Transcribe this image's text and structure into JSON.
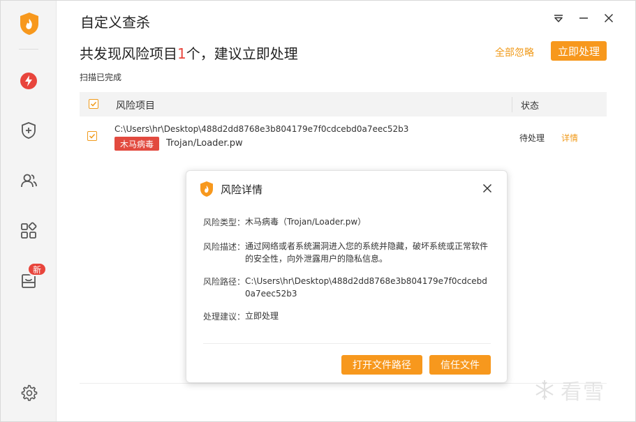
{
  "window": {
    "title": "自定义查杀"
  },
  "sidebar": {
    "items": [
      {
        "name": "quick-scan",
        "icon": "lightning-icon"
      },
      {
        "name": "protection",
        "icon": "shield-plus-icon"
      },
      {
        "name": "accounts",
        "icon": "users-icon"
      },
      {
        "name": "apps",
        "icon": "apps-grid-icon"
      },
      {
        "name": "toolbox",
        "icon": "box-icon",
        "badge": "新"
      },
      {
        "name": "settings",
        "icon": "gear-icon"
      }
    ]
  },
  "header": {
    "headline_prefix": "共发现风险项目",
    "headline_count": "1",
    "headline_suffix": "个，建议立即处理",
    "ignore_all": "全部忽略",
    "handle_now": "立即处理",
    "scan_status": "扫描已完成"
  },
  "table": {
    "col_risk": "风险项目",
    "col_status": "状态",
    "rows": [
      {
        "path": "C:\\Users\\hr\\Desktop\\488d2dd8768e3b804179e7f0cdcebd0a7eec52b3",
        "tag": "木马病毒",
        "name": "Trojan/Loader.pw",
        "status": "待处理",
        "detail": "详情"
      }
    ]
  },
  "modal": {
    "title": "风险详情",
    "type_label": "风险类型：",
    "type_value": "木马病毒（Trojan/Loader.pw）",
    "desc_label": "风险描述：",
    "desc_value": "通过网络或者系统漏洞进入您的系统并隐藏，破坏系统或正常软件的安全性，向外泄露用户的隐私信息。",
    "path_label": "风险路径：",
    "path_value": "C:\\Users\\hr\\Desktop\\488d2dd8768e3b804179e7f0cdcebd0a7eec52b3",
    "advice_label": "处理建议：",
    "advice_value": "立即处理",
    "btn_open_path": "打开文件路径",
    "btn_trust": "信任文件"
  },
  "watermark": {
    "text": "看雪"
  },
  "colors": {
    "accent": "#f7981d",
    "danger": "#e24a3f",
    "link": "#f09a1a"
  }
}
